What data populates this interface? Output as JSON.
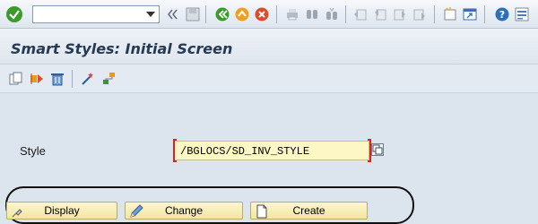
{
  "window": {
    "title": "Smart Styles: Initial Screen"
  },
  "toolbar": {
    "command_field_value": "",
    "icons": [
      "checkmark-icon",
      "save-icon",
      "back-icon",
      "exit-icon",
      "cancel-icon",
      "print-icon",
      "find-icon",
      "find-next-icon",
      "first-page-icon",
      "previous-page-icon",
      "next-page-icon",
      "last-page-icon",
      "create-session-icon",
      "shortcut-icon",
      "help-icon",
      "layout-menu-icon"
    ]
  },
  "app_toolbar": {
    "icons": [
      "copy-icon",
      "rename-icon",
      "delete-icon",
      "wizard-icon",
      "hierarchy-icon"
    ]
  },
  "form": {
    "style_label": "Style",
    "style_value": "/BGLOCS/SD_INV_STYLE"
  },
  "buttons": {
    "display": "Display",
    "change": "Change",
    "create": "Create"
  },
  "colors": {
    "accent_green": "#3a9a2a",
    "button_yellow": "#f6eeb6",
    "required_red": "#dd2222"
  }
}
